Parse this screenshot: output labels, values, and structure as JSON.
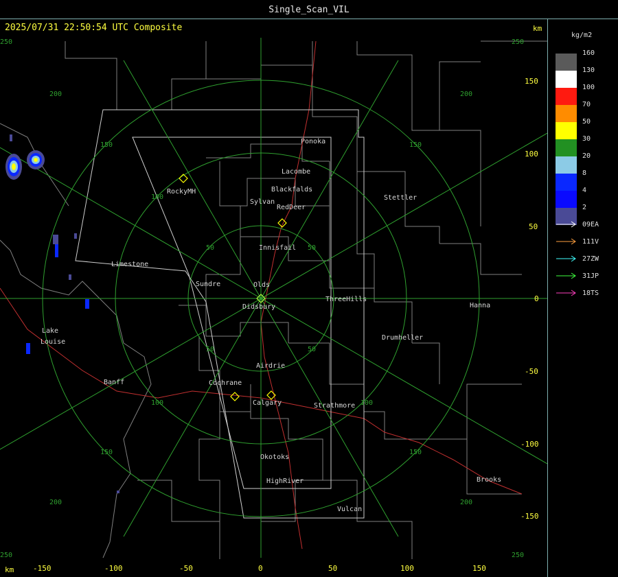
{
  "window": {
    "title": "Single_Scan_VIL"
  },
  "header": {
    "timestamp": "2025/07/31 22:50:54 UTC Composite",
    "km_top": "km",
    "km_bottom": "km"
  },
  "axes": {
    "x_ticks": [
      "-150",
      "-100",
      "-50",
      "0",
      "50",
      "100",
      "150"
    ],
    "y_ticks": [
      "150",
      "100",
      "50",
      "0",
      "-50",
      "-100",
      "-150"
    ]
  },
  "range_rings": [
    "50",
    "100",
    "150",
    "200",
    "250"
  ],
  "places": [
    "Ponoka",
    "Lacombe",
    "Blackfalds",
    "Sylvan",
    "RedDeer",
    "RockyMH",
    "Stettler",
    "Innisfail",
    "Limestone",
    "Sundre",
    "Olds",
    "Didsbury",
    "ThreeHills",
    "Hanna",
    "Lake",
    "Louise",
    "Drumheller",
    "Airdrie",
    "Banff",
    "Cochrane",
    "Calgary",
    "Strathmore",
    "Okotoks",
    "HighRiver",
    "Brooks",
    "Vulcan"
  ],
  "legend": {
    "unit": "kg/m2",
    "levels": [
      {
        "label": "160",
        "color": "#5a5a5a"
      },
      {
        "label": "130",
        "color": "#ffffff"
      },
      {
        "label": "100",
        "color": "#ff1a10"
      },
      {
        "label": "70",
        "color": "#ff8c00"
      },
      {
        "label": "50",
        "color": "#ffff00"
      },
      {
        "label": "30",
        "color": "#229022"
      },
      {
        "label": "20",
        "color": "#8ccbe6"
      },
      {
        "label": "8",
        "color": "#0a28ff"
      },
      {
        "label": "4",
        "color": "#0a0aff"
      },
      {
        "label": "2",
        "color": "#4a4a96"
      }
    ],
    "radars": [
      {
        "label": "09EA",
        "color": "#ffffff"
      },
      {
        "label": "111V",
        "color": "#ffa040"
      },
      {
        "label": "27ZW",
        "color": "#40ffff"
      },
      {
        "label": "31JP",
        "color": "#40ff40"
      },
      {
        "label": "18TS",
        "color": "#ff40c0"
      }
    ]
  }
}
